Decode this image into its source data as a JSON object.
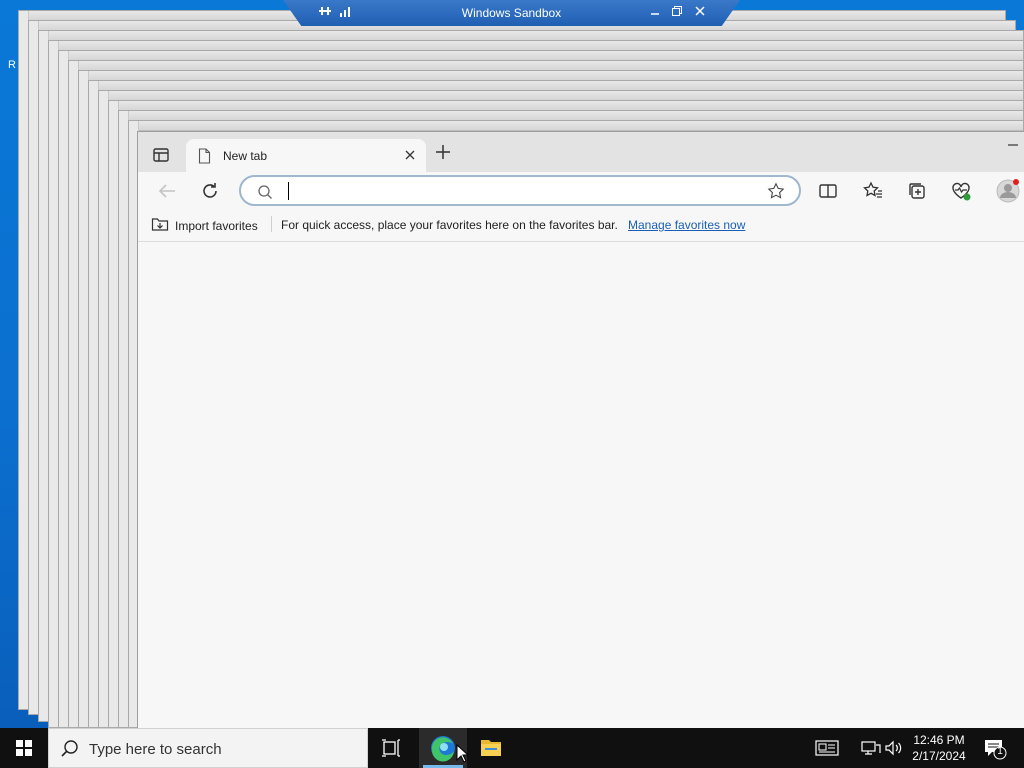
{
  "desktop": {
    "left_glyph": "R"
  },
  "sandbox": {
    "title": "Windows Sandbox"
  },
  "browser": {
    "tab_label": "New tab",
    "address_value": "",
    "address_placeholder": "",
    "favorites_bar": {
      "import_label": "Import favorites",
      "message": "For quick access, place your favorites here on the favorites bar.",
      "manage_link": "Manage favorites now"
    }
  },
  "taskbar": {
    "search_placeholder": "Type here to search",
    "time": "12:46 PM",
    "date": "2/17/2024",
    "notification_count": "1"
  },
  "icons": [
    "tab-actions-icon",
    "page-icon",
    "close-icon",
    "plus-icon",
    "back-arrow-icon",
    "refresh-icon",
    "search-icon",
    "favorite-star-icon",
    "split-screen-icon",
    "favorites-icon",
    "collections-icon",
    "browser-essentials-icon",
    "profile-icon",
    "windows-start-icon",
    "task-view-icon",
    "edge-icon",
    "file-explorer-icon",
    "news-icon",
    "network-icon",
    "volume-icon",
    "notification-icon"
  ]
}
